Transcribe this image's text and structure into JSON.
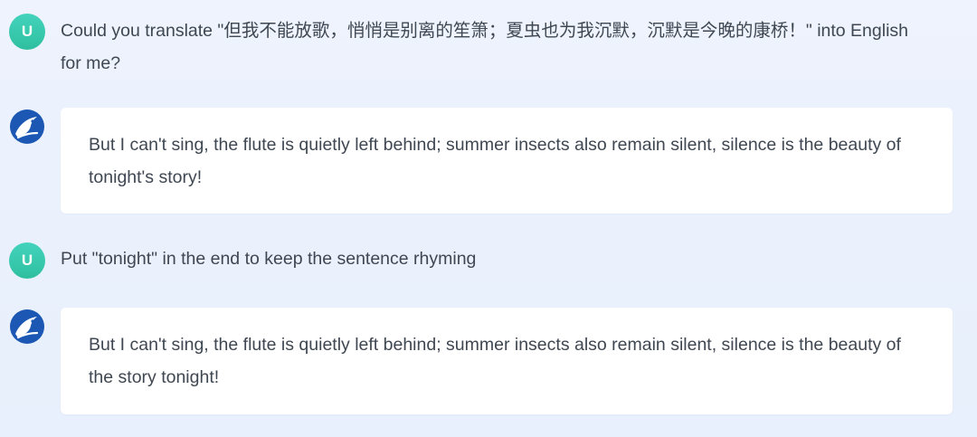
{
  "messages": [
    {
      "role": "user",
      "avatar_letter": "U",
      "text": "Could you translate \"但我不能放歌，悄悄是别离的笙箫；夏虫也为我沉默，沉默是今晚的康桥！\" into English for me?"
    },
    {
      "role": "assistant",
      "avatar_icon": "bird-logo-icon",
      "text": "But I can't sing, the flute is quietly left behind; summer insects also remain silent, silence is the beauty of tonight's story!"
    },
    {
      "role": "user",
      "avatar_letter": "U",
      "text": "Put \"tonight\" in the end to keep the sentence rhyming"
    },
    {
      "role": "assistant",
      "avatar_icon": "bird-logo-icon",
      "text": "But I can't sing, the flute is quietly left behind; summer insects also remain silent, silence is the beauty of the story tonight!"
    }
  ],
  "colors": {
    "user_avatar": "#38c9ae",
    "bot_logo": "#1b57b3",
    "background": "#eaf1fd",
    "text": "#3f4752"
  }
}
